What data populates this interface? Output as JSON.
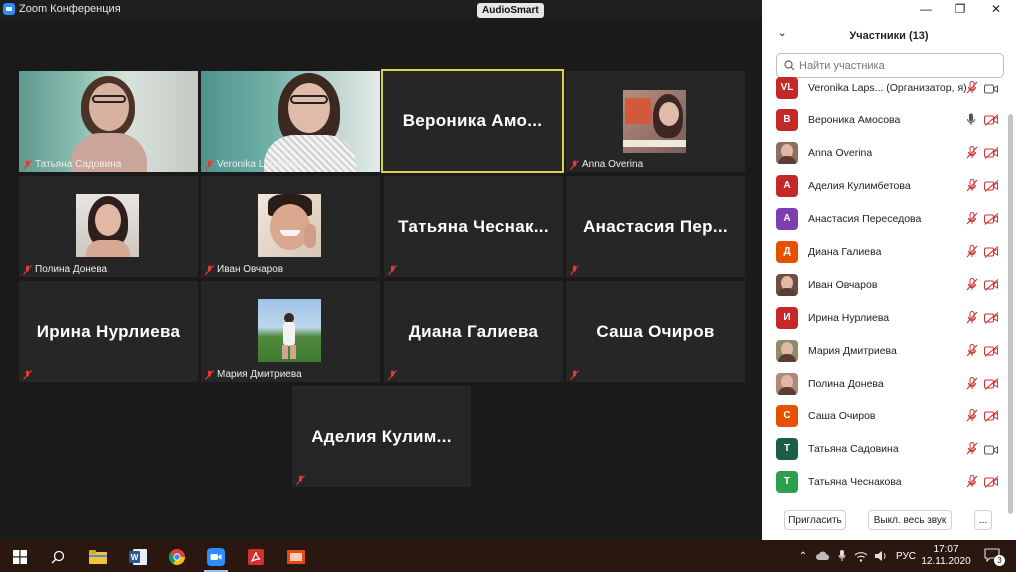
{
  "window": {
    "title": "Zoom Конференция",
    "badge": "AudioSmart",
    "minimize_glyph": "—",
    "restore_glyph": "❐",
    "close_glyph": "✕"
  },
  "tiles": [
    {
      "caption": "Татьяна Садовина",
      "big": "",
      "video": true
    },
    {
      "caption": "Veronika Lapshina",
      "big": "",
      "video": true
    },
    {
      "caption": "",
      "big": "Вероника  Амо...",
      "video": false,
      "active": true
    },
    {
      "caption": "Anna Overina",
      "big": "",
      "video": true
    },
    {
      "caption": "Полина Донева",
      "big": "",
      "video": true
    },
    {
      "caption": "Иван Овчаров",
      "big": "",
      "video": true
    },
    {
      "caption": "",
      "big": "Татьяна  Чеснак...",
      "video": false
    },
    {
      "caption": "",
      "big": "Анастасия  Пер...",
      "video": false
    },
    {
      "caption": "",
      "big": "Ирина Нурлиева",
      "video": false
    },
    {
      "caption": "Мария Дмитриева",
      "big": "",
      "video": true
    },
    {
      "caption": "",
      "big": "Диана Галиева",
      "video": false
    },
    {
      "caption": "",
      "big": "Саша Очиров",
      "video": false
    },
    {
      "caption": "",
      "big": "Аделия  Кулим...",
      "video": false
    }
  ],
  "panel": {
    "title": "Участники (13)",
    "search_placeholder": "Найти участника",
    "participants": [
      {
        "name": "Veronika Laps... (Организатор, я)",
        "initials": "VL",
        "color": "#c62828",
        "mic": "off",
        "cam": "on"
      },
      {
        "name": "Вероника Амосова",
        "initials": "В",
        "color": "#c62828",
        "mic": "on",
        "cam": "off"
      },
      {
        "name": "Anna Overina",
        "initials": "",
        "color": "#8d6e63",
        "mic": "off",
        "cam": "off",
        "photo": true
      },
      {
        "name": "Аделия Кулимбетова",
        "initials": "А",
        "color": "#c62828",
        "mic": "off",
        "cam": "off"
      },
      {
        "name": "Анастасия Переседова",
        "initials": "А",
        "color": "#7b3fb2",
        "mic": "off",
        "cam": "off"
      },
      {
        "name": "Диана Галиева",
        "initials": "Д",
        "color": "#e65100",
        "mic": "off",
        "cam": "off"
      },
      {
        "name": "Иван Овчаров",
        "initials": "",
        "color": "#6d4c41",
        "mic": "off",
        "cam": "off",
        "photo": true
      },
      {
        "name": "Ирина Нурлиева",
        "initials": "И",
        "color": "#c62828",
        "mic": "off",
        "cam": "off"
      },
      {
        "name": "Мария Дмитриева",
        "initials": "",
        "color": "#8d8d6a",
        "mic": "off",
        "cam": "off",
        "photo": true
      },
      {
        "name": "Полина Донева",
        "initials": "",
        "color": "#b08a78",
        "mic": "off",
        "cam": "off",
        "photo": true
      },
      {
        "name": "Саша Очиров",
        "initials": "С",
        "color": "#e65100",
        "mic": "off",
        "cam": "off"
      },
      {
        "name": "Татьяна Садовина",
        "initials": "Т",
        "color": "#1b5e45",
        "mic": "off",
        "cam": "on"
      },
      {
        "name": "Татьяна Чеснакова",
        "initials": "Т",
        "color": "#2e9e4f",
        "mic": "off",
        "cam": "off"
      }
    ],
    "invite_label": "Пригласить",
    "mute_all_label": "Выкл. весь звук",
    "more_label": "..."
  },
  "taskbar": {
    "lang": "РУС",
    "time": "17:07",
    "date": "12.11.2020",
    "notifications": "3"
  }
}
